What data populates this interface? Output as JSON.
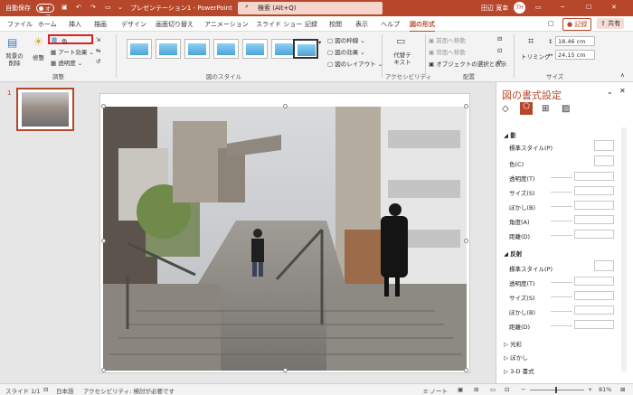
{
  "titlebar": {
    "autosave": "自動保存",
    "toggle": "オフ",
    "doc_title": "プレゼンテーション1 - PowerPoint",
    "search_placeholder": "検索 (Alt+Q)",
    "user": "田辺 寛幸",
    "user_initials": "TH"
  },
  "tabs": [
    "ファイル",
    "ホーム",
    "挿入",
    "描画",
    "デザイン",
    "画面切り替え",
    "アニメーション",
    "スライド ショー",
    "記録",
    "校閲",
    "表示",
    "ヘルプ",
    "図の形式"
  ],
  "tab_actions": {
    "record": "記録",
    "share": "共有"
  },
  "ribbon": {
    "remove_bg": "背景の削除",
    "corrections": "修整",
    "color": "色",
    "artistic": "アート効果",
    "transparency": "透明度",
    "group_adjust": "調整",
    "group_styles": "図のスタイル",
    "border": "図の枠線",
    "effects": "図の効果",
    "layout": "図のレイアウト",
    "alt_text": "代替テキスト",
    "group_access": "アクセシビリティ",
    "bring_forward": "前面へ移動",
    "send_backward": "背面へ移動",
    "selection_pane": "オブジェクトの選択と表示",
    "group_arrange": "配置",
    "crop": "トリミング",
    "height": "18.46 cm",
    "width": "24.15 cm",
    "group_size": "サイズ"
  },
  "slide_number": "1",
  "format_pane": {
    "title": "図の書式設定",
    "shadow_section": "影",
    "shadow_rows": [
      "標準スタイル(P)",
      "色(C)",
      "透明度(T)",
      "サイズ(S)",
      "ぼかし(B)",
      "角度(A)",
      "距離(D)"
    ],
    "reflection_section": "反射",
    "reflection_rows": [
      "標準スタイル(P)",
      "透明度(T)",
      "サイズ(S)",
      "ぼかし(B)",
      "距離(D)"
    ],
    "collapsed_sections": [
      "光彩",
      "ぼかし",
      "3-D 書式"
    ]
  },
  "status": {
    "slide": "スライド 1/1",
    "lang": "日本語",
    "accessibility": "アクセシビリティ: 検討が必要です",
    "notes": "ノート",
    "zoom": "81%"
  },
  "colors": {
    "accent": "#b7472a",
    "highlight": "#e02020"
  }
}
